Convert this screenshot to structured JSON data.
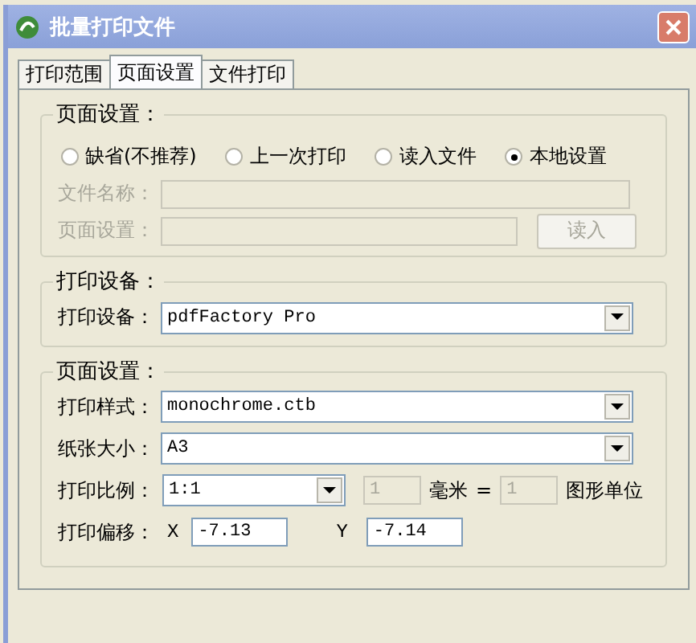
{
  "window": {
    "title": "批量打印文件"
  },
  "tabs": [
    {
      "label": "打印范围",
      "selected": false
    },
    {
      "label": "页面设置",
      "selected": true
    },
    {
      "label": "文件打印",
      "selected": false
    }
  ],
  "page_source": {
    "title": "页面设置：",
    "options": [
      {
        "label": "缺省(不推荐)",
        "selected": false
      },
      {
        "label": "上一次打印",
        "selected": false
      },
      {
        "label": "读入文件",
        "selected": false
      },
      {
        "label": "本地设置",
        "selected": true
      }
    ],
    "file_name": {
      "label": "文件名称：",
      "disabled": true
    },
    "page_setup": {
      "label": "页面设置：",
      "disabled": true
    },
    "read_button": {
      "label": "读入",
      "disabled": true
    }
  },
  "printer": {
    "title": "打印设备：",
    "label": "打印设备：",
    "value": "pdfFactory Pro"
  },
  "page_settings": {
    "title": "页面设置：",
    "style": {
      "label": "打印样式：",
      "value": "monochrome.ctb"
    },
    "paper": {
      "label": "纸张大小：",
      "value": "A3"
    },
    "scale": {
      "label": "打印比例：",
      "value": "1:1",
      "mm_value": "1",
      "mm_label": "毫米",
      "equals": "=",
      "units_value": "1",
      "units_label": "图形单位",
      "disabled": true
    },
    "offset": {
      "label": "打印偏移：",
      "x_label": "X",
      "x_value": "-7.13",
      "y_label": "Y",
      "y_value": "-7.14"
    }
  }
}
